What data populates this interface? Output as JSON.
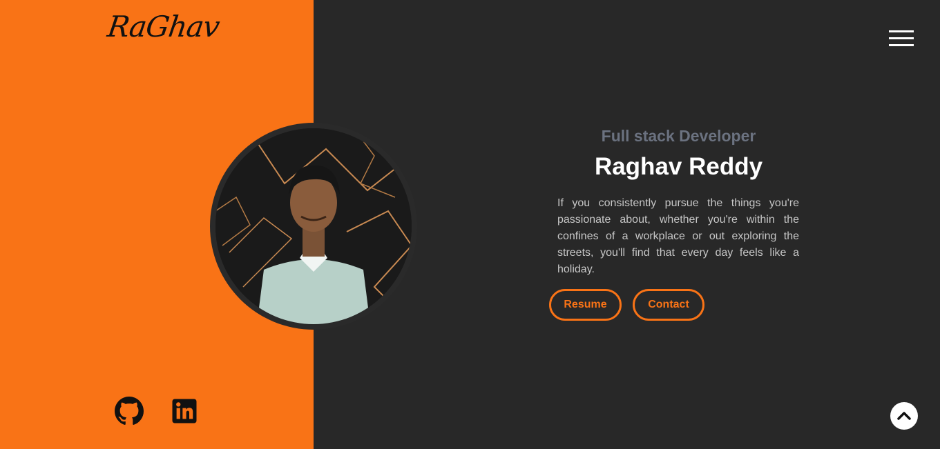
{
  "brand": {
    "logo_text": "RaGhav"
  },
  "nav": {
    "menu_icon": "hamburger-menu-icon"
  },
  "hero": {
    "role": "Full stack Developer",
    "name": "Raghav Reddy",
    "bio": "If you consistently pursue the things you're passionate about, whether you're within the confines of a workplace or out exploring the streets, you'll find that every day feels like a holiday.",
    "resume_label": "Resume",
    "contact_label": "Contact"
  },
  "social": [
    {
      "icon": "github-icon"
    },
    {
      "icon": "linkedin-icon"
    }
  ],
  "scroll_top_icon": "chevron-up-icon",
  "colors": {
    "accent": "#f97316",
    "background": "#282828",
    "muted_text": "#6b7280",
    "body_text": "#c7c7c7"
  }
}
